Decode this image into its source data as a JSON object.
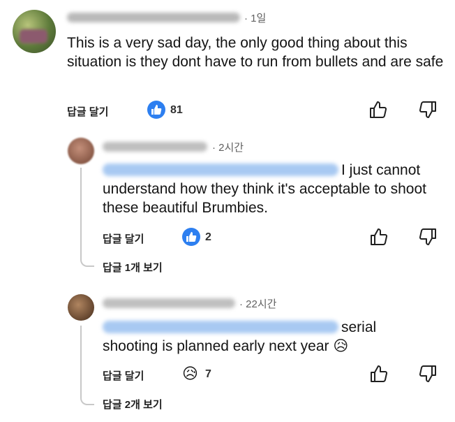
{
  "comments": [
    {
      "time": "· 1일",
      "text": "This is a very sad day, the only good thing about this situation is they dont have to run from bullets and are safe",
      "reply_label": "답글 달기",
      "reaction_count": "81"
    },
    {
      "time": "· 2시간",
      "text": "I just cannot understand how they think it's acceptable to shoot these beautiful Brumbies.",
      "reply_label": "답글 달기",
      "reaction_count": "2",
      "replies_label": "답글 1개 보기"
    },
    {
      "time": "· 22시간",
      "text_line1": "serial",
      "text_line2": "shooting is planned early next year",
      "text_emoji": "😥",
      "reply_label": "답글 달기",
      "reaction_emoji": "😥",
      "reaction_count": "7",
      "replies_label": "답글 2개 보기"
    }
  ],
  "icons": {
    "like": "thumbs-up-icon",
    "dislike": "thumbs-down-icon",
    "reaction_like": "like-reaction-icon",
    "reaction_sad": "sad-reaction-icon"
  },
  "colors": {
    "reaction_blue": "#2d7ff0",
    "mention_blue": "#a8c9f2"
  }
}
